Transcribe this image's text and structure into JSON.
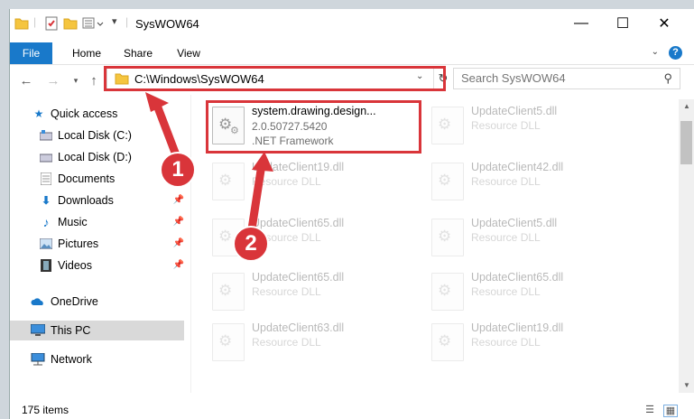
{
  "window": {
    "title": "SysWOW64",
    "controls": {
      "minimize": "—",
      "maximize": "☐",
      "close": "✕"
    }
  },
  "ribbon": {
    "tabs": [
      "File",
      "Home",
      "Share",
      "View"
    ],
    "help": "?"
  },
  "address": {
    "path": "C:\\Windows\\SysWOW64",
    "search_placeholder": "Search SysWOW64"
  },
  "sidebar": {
    "items": [
      {
        "label": "Quick access",
        "icon": "star-icon"
      },
      {
        "label": "Local Disk (C:)",
        "icon": "drive-icon"
      },
      {
        "label": "Local Disk (D:)",
        "icon": "drive-icon"
      },
      {
        "label": "Documents",
        "icon": "documents-icon"
      },
      {
        "label": "Downloads",
        "icon": "downloads-icon"
      },
      {
        "label": "Music",
        "icon": "music-icon"
      },
      {
        "label": "Pictures",
        "icon": "pictures-icon"
      },
      {
        "label": "Videos",
        "icon": "videos-icon"
      },
      {
        "label": "OneDrive",
        "icon": "onedrive-icon"
      },
      {
        "label": "This PC",
        "icon": "computer-icon"
      },
      {
        "label": "Network",
        "icon": "network-icon"
      }
    ]
  },
  "files": {
    "highlighted": {
      "name": "system.drawing.design...",
      "version": "2.0.50727.5420",
      "description": ".NET Framework"
    },
    "faded": [
      {
        "name": "UpdateClient5.dll",
        "type": "Resource DLL"
      },
      {
        "name": "UpdateClient19.dll",
        "type": "Resource DLL"
      },
      {
        "name": "UpdateClient42.dll",
        "type": "Resource DLL"
      },
      {
        "name": "UpdateClient65.dll",
        "type": "Resource DLL"
      },
      {
        "name": "UpdateClient5.dll",
        "type": "Resource DLL"
      },
      {
        "name": "UpdateClient65.dll",
        "type": "Resource DLL"
      },
      {
        "name": "UpdateClient65.dll",
        "type": "Resource DLL"
      },
      {
        "name": "UpdateClient63.dll",
        "type": "Resource DLL"
      },
      {
        "name": "UpdateClient19.dll",
        "type": "Resource DLL"
      }
    ]
  },
  "callouts": [
    "1",
    "2"
  ],
  "status": {
    "item_count": "175 items"
  },
  "colors": {
    "accent": "#1979ca",
    "annotation": "#d9353a"
  }
}
